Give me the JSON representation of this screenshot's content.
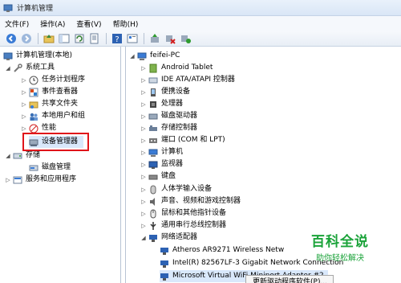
{
  "window": {
    "title": "计算机管理"
  },
  "menu": [
    "文件(F)",
    "操作(A)",
    "查看(V)",
    "帮助(H)"
  ],
  "toolbar": {
    "icons": [
      "back-icon",
      "forward-icon",
      "up-folder-icon",
      "show-tree-icon",
      "refresh-icon",
      "export-icon",
      "help-icon",
      "properties-icon",
      "update-driver-icon",
      "disable-device-icon",
      "uninstall-device-icon",
      "scan-hardware-icon"
    ]
  },
  "left_tree": {
    "root": "计算机管理(本地)",
    "system_tools": "系统工具",
    "task_scheduler": "任务计划程序",
    "event_viewer": "事件查看器",
    "shared_folders": "共享文件夹",
    "local_users": "本地用户和组",
    "performance": "性能",
    "device_manager": "设备管理器",
    "storage": "存储",
    "disk_management": "磁盘管理",
    "services": "服务和应用程序"
  },
  "right_tree": {
    "computer": "feifei-PC",
    "categories": [
      "Android Tablet",
      "IDE ATA/ATAPI 控制器",
      "便携设备",
      "处理器",
      "磁盘驱动器",
      "存储控制器",
      "端口 (COM 和 LPT)",
      "计算机",
      "监视器",
      "键盘",
      "人体学输入设备",
      "声音、视频和游戏控制器",
      "鼠标和其他指针设备",
      "通用串行总线控制器",
      "网络适配器"
    ],
    "network_adapters": [
      "Atheros AR9271 Wireless Netw",
      "Intel(R) 82567LF-3 Gigabit Network Connection",
      "Microsoft Virtual WiFi Miniport Adapter #2"
    ]
  },
  "context_menu": {
    "first_item": "更新驱动程序软件(P)..."
  },
  "watermark": {
    "main": "百科全说",
    "sub": "助你轻松解决"
  },
  "colors": {
    "highlight": "#e0141a",
    "watermark": "#1ba33a",
    "selection": "#d9e8fb"
  }
}
